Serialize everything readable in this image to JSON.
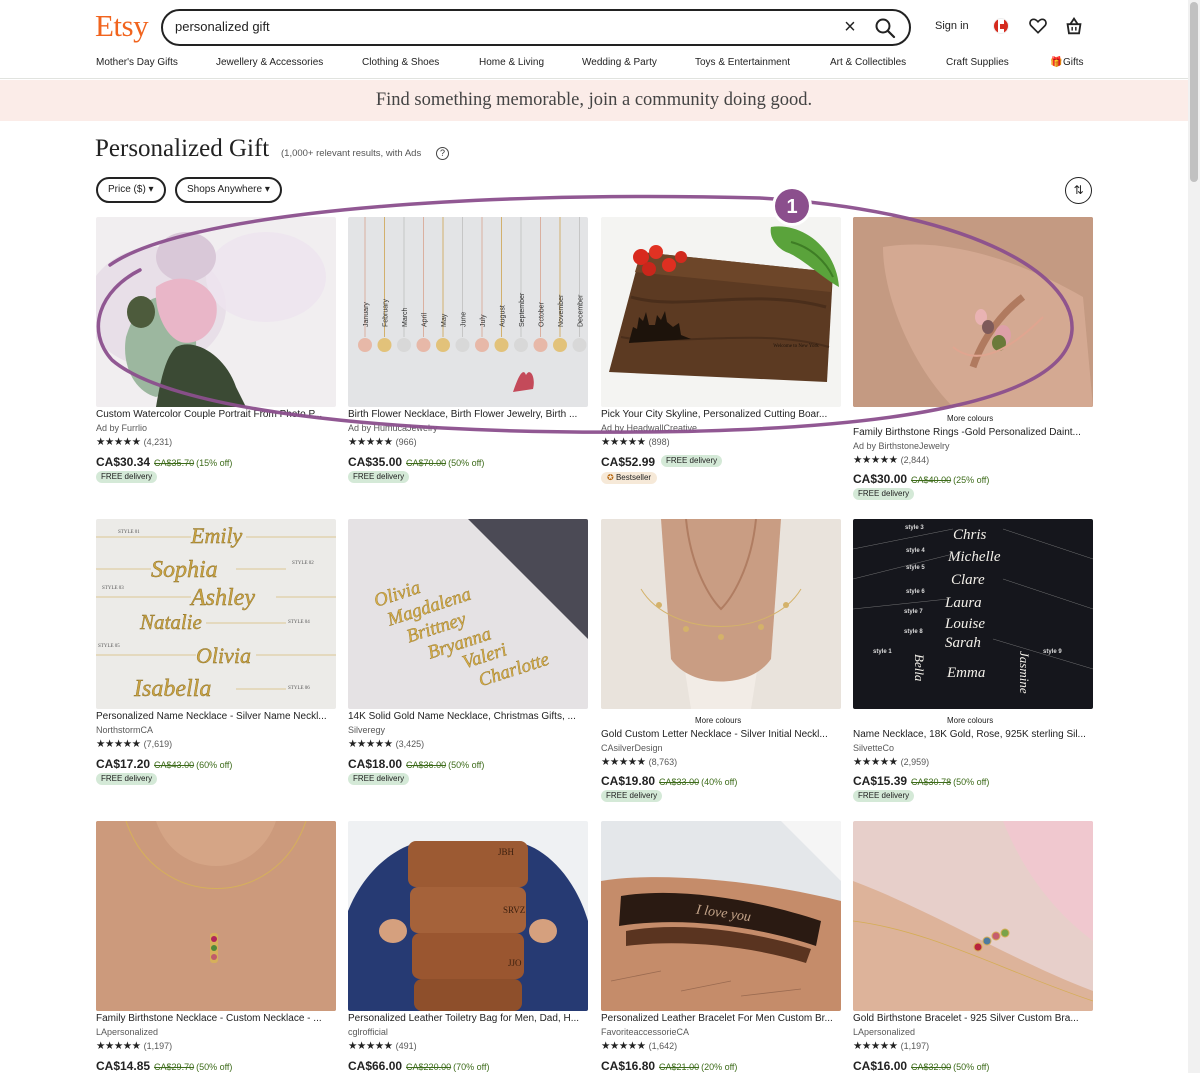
{
  "header": {
    "logo": "Etsy",
    "search_value": "personalized gift",
    "sign_in": "Sign in"
  },
  "nav": [
    "Mother's Day Gifts",
    "Jewellery & Accessories",
    "Clothing & Shoes",
    "Home & Living",
    "Wedding & Party",
    "Toys & Entertainment",
    "Art & Collectibles",
    "Craft Supplies",
    "Gifts"
  ],
  "banner": "Find something memorable, join a community doing good.",
  "page": {
    "title": "Personalized Gift",
    "results": "(1,000+ relevant results, with Ads",
    "help": "?",
    "filters": [
      "Price ($) ▾",
      "Shops Anywhere ▾"
    ],
    "sort_icon": "⇅"
  },
  "annotation": {
    "number": "1",
    "color": "#8b4f8d"
  },
  "listings": [
    {
      "title": "Custom Watercolor Couple Portrait From Photo P...",
      "shop": "Ad by Furrlio",
      "stars": "★★★★★",
      "reviews": "(4,231)",
      "price": "CA$30.34",
      "original": "CA$35.70",
      "discount": "(15% off)",
      "badge": "FREE delivery"
    },
    {
      "title": "Birth Flower Necklace, Birth Flower Jewelry, Birth ...",
      "shop": "Ad by HumucaJewelry",
      "stars": "★★★★★",
      "reviews": "(966)",
      "price": "CA$35.00",
      "original": "CA$70.00",
      "discount": "(50% off)",
      "badge": "FREE delivery",
      "months": [
        "January",
        "February",
        "March",
        "April",
        "May",
        "June",
        "July",
        "August",
        "September",
        "October",
        "November",
        "December"
      ]
    },
    {
      "title": "Pick Your City Skyline, Personalized Cutting Boar...",
      "shop": "Ad by HeadwallCreative",
      "stars": "★★★★★",
      "reviews": "(898)",
      "price": "CA$52.99",
      "badge": "FREE delivery",
      "bestseller": "Bestseller",
      "board_text": "Welcome to New York"
    },
    {
      "title": "Family Birthstone Rings -Gold Personalized Daint...",
      "shop": "Ad by BirthstoneJewelry",
      "stars": "★★★★★",
      "reviews": "(2,844)",
      "price": "CA$30.00",
      "original": "CA$40.00",
      "discount": "(25% off)",
      "badge": "FREE delivery",
      "more": "More colours"
    },
    {
      "title": "Personalized Name Necklace - Silver Name Neckl...",
      "shop": "NorthstormCA",
      "stars": "★★★★★",
      "reviews": "(7,619)",
      "price": "CA$17.20",
      "original": "CA$43.00",
      "discount": "(60% off)",
      "badge": "FREE delivery",
      "names": [
        "Emily",
        "Sophia",
        "Ashley",
        "Natalie",
        "Olivia",
        "Isabella"
      ],
      "styles": [
        "STYLE 01",
        "STYLE 02",
        "STYLE 03",
        "STYLE 04",
        "STYLE 05",
        "STYLE 06"
      ]
    },
    {
      "title": "14K Solid Gold Name Necklace, Christmas Gifts, ...",
      "shop": "Silveregy",
      "stars": "★★★★★",
      "reviews": "(3,425)",
      "price": "CA$18.00",
      "original": "CA$36.00",
      "discount": "(50% off)",
      "badge": "FREE delivery",
      "names": [
        "Olivia",
        "Magdalena",
        "Brittney",
        "Bryanna",
        "Valeri",
        "Charlotte"
      ]
    },
    {
      "title": "Gold Custom Letter Necklace - Silver Initial Neckl...",
      "shop": "CAsilverDesign",
      "stars": "★★★★★",
      "reviews": "(8,763)",
      "price": "CA$19.80",
      "original": "CA$33.00",
      "discount": "(40% off)",
      "badge": "FREE delivery",
      "more": "More colours"
    },
    {
      "title": "Name Necklace, 18K Gold, Rose, 925K sterling Sil...",
      "shop": "SilvetteCo",
      "stars": "★★★★★",
      "reviews": "(2,959)",
      "price": "CA$15.39",
      "original": "CA$30.78",
      "discount": "(50% off)",
      "badge": "FREE delivery",
      "more": "More colours",
      "names": [
        "Chris",
        "Michelle",
        "Clare",
        "Laura",
        "Louise",
        "Sarah",
        "Emma",
        "Bella",
        "Jasmine"
      ],
      "styles": [
        "style 3",
        "style 4",
        "style 5",
        "style 6",
        "style 7",
        "style 8",
        "style 1",
        "style 9"
      ]
    },
    {
      "title": "Family Birthstone Necklace - Custom Necklace - ...",
      "shop": "LApersonalized",
      "stars": "★★★★★",
      "reviews": "(1,197)",
      "price": "CA$14.85",
      "original": "CA$29.70",
      "discount": "(50% off)"
    },
    {
      "title": "Personalized Leather Toiletry Bag for Men, Dad, H...",
      "shop": "cglrofficial",
      "stars": "★★★★★",
      "reviews": "(491)",
      "price": "CA$66.00",
      "original": "CA$220.00",
      "discount": "(70% off)",
      "bag_initials": [
        "JBH",
        "SRVZ",
        "JJO"
      ]
    },
    {
      "title": "Personalized Leather Bracelet For Men Custom Br...",
      "shop": "FavoriteaccessorieCA",
      "stars": "★★★★★",
      "reviews": "(1,642)",
      "price": "CA$16.80",
      "original": "CA$21.00",
      "discount": "(20% off)",
      "engraving": "I love you"
    },
    {
      "title": "Gold Birthstone Bracelet - 925 Silver Custom Bra...",
      "shop": "LApersonalized",
      "stars": "★★★★★",
      "reviews": "(1,197)",
      "price": "CA$16.00",
      "original": "CA$32.00",
      "discount": "(50% off)"
    }
  ]
}
